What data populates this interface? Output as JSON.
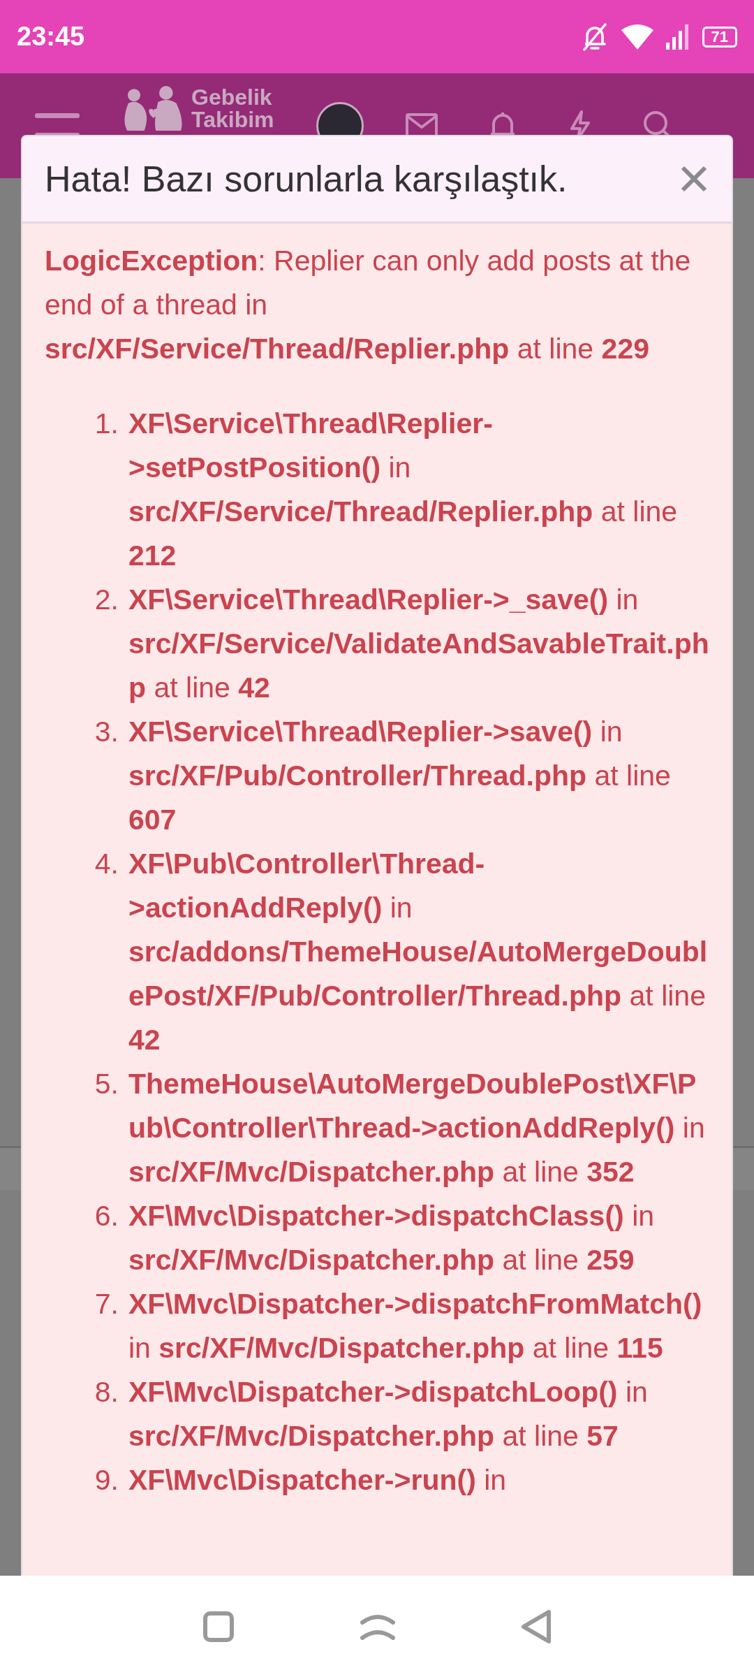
{
  "status_bar": {
    "time": "23:45",
    "battery": "71"
  },
  "header": {
    "logo_lines": [
      "Gebelik",
      "Takibim"
    ]
  },
  "dialog": {
    "title": "Hata! Bazı sorunlarla karşılaştık.",
    "message": "**LogicException**: Replier can only add posts at the end of a thread in **src/XF/Service/Thread/Replier.php** at line **229**",
    "trace": [
      {
        "number": "1.",
        "text": "**XF\\Service\\Thread\\Replier->setPostPosition()** in **src/XF/Service/Thread/Replier.php** at line **212**"
      },
      {
        "number": "2.",
        "text": "**XF\\Service\\Thread\\Replier->_save()** in **src/XF/Service/ValidateAndSavableTrait.php** at line **42**"
      },
      {
        "number": "3.",
        "text": "**XF\\Service\\Thread\\Replier->save()** in **src/XF/Pub/Controller/Thread.php** at line **607**"
      },
      {
        "number": "4.",
        "text": "**XF\\Pub\\Controller\\Thread->actionAddReply()** in **src/addons/ThemeHouse/AutoMergeDoublePost/XF/Pub/Controller/Thread.php** at line **42**"
      },
      {
        "number": "5.",
        "text": "**ThemeHouse\\AutoMergeDoublePost\\XF\\Pub\\Controller\\Thread->actionAddReply()** in **src/XF/Mvc/Dispatcher.php** at line **352**"
      },
      {
        "number": "6.",
        "text": "**XF\\Mvc\\Dispatcher->dispatchClass()** in **src/XF/Mvc/Dispatcher.php** at line **259**"
      },
      {
        "number": "7.",
        "text": "**XF\\Mvc\\Dispatcher->dispatchFromMatch()** in **src/XF/Mvc/Dispatcher.php** at line **115**"
      },
      {
        "number": "8.",
        "text": "**XF\\Mvc\\Dispatcher->dispatchLoop()** in **src/XF/Mvc/Dispatcher.php** at line **57**"
      },
      {
        "number": "9.",
        "text": "**XF\\Mvc\\Dispatcher->run()** in"
      }
    ]
  }
}
